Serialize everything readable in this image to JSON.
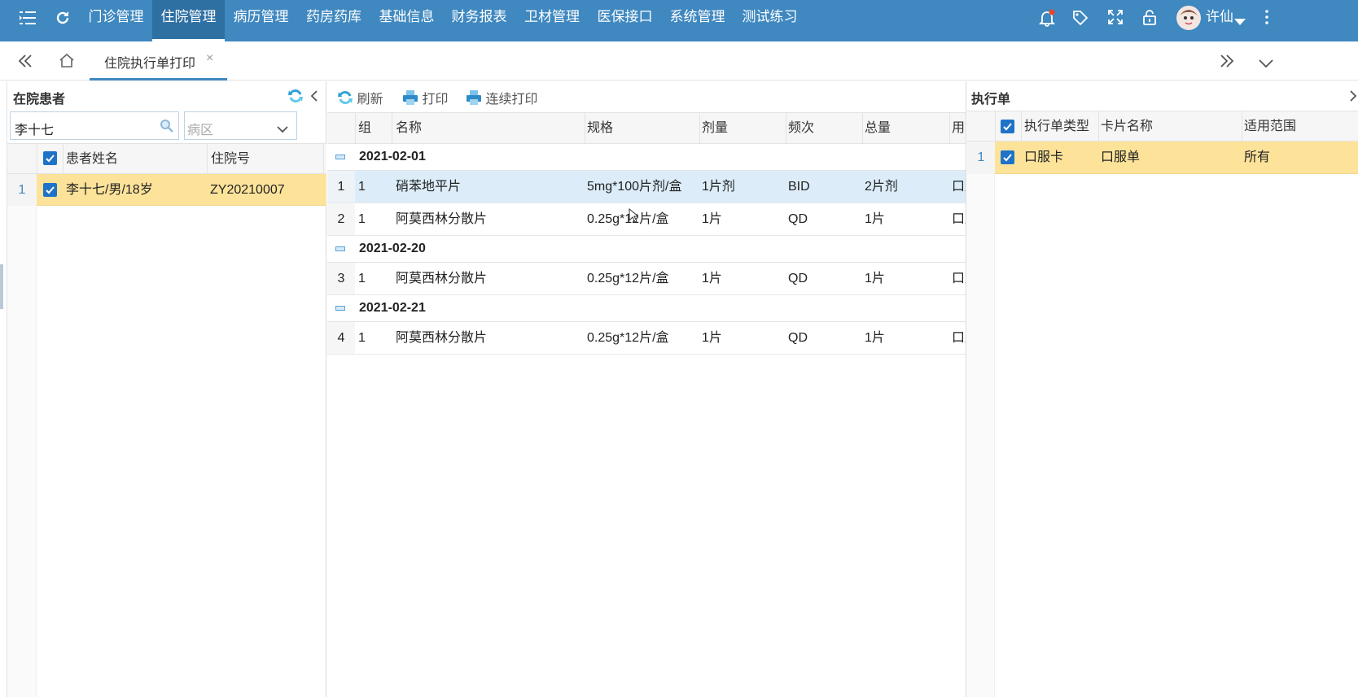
{
  "topbar": {
    "menu": [
      "门诊管理",
      "住院管理",
      "病历管理",
      "药房药库",
      "基础信息",
      "财务报表",
      "卫材管理",
      "医保接口",
      "系统管理",
      "测试练习"
    ],
    "active_index": 1,
    "user": "许仙",
    "icons": [
      "menu-toggle-icon",
      "refresh-icon",
      "bell-icon",
      "tag-icon",
      "fullscreen-icon",
      "lock-icon",
      "avatar",
      "more-icon"
    ]
  },
  "tabstrip": {
    "tab_label": "住院执行单打印",
    "close": "×"
  },
  "left": {
    "title": "在院患者",
    "search_value": "李十七",
    "ward_placeholder": "病区",
    "headers": [
      "患者姓名",
      "住院号"
    ],
    "rows": [
      {
        "num": "1",
        "name": "李十七/男/18岁",
        "inpatient_no": "ZY20210007",
        "checked": true
      }
    ]
  },
  "middle": {
    "toolbar": {
      "refresh": "刷新",
      "print": "打印",
      "continuous_print": "连续打印"
    },
    "headers": [
      "组",
      "名称",
      "规格",
      "剂量",
      "频次",
      "总量",
      "用法"
    ],
    "groups": [
      {
        "date": "2021-02-01",
        "rows": [
          {
            "num": "1",
            "group": "1",
            "name": "硝苯地平片",
            "spec": "5mg*100片剂/盒",
            "dose": "1片剂",
            "freq": "BID",
            "total": "2片剂",
            "usage": "口服"
          },
          {
            "num": "2",
            "group": "1",
            "name": "阿莫西林分散片",
            "spec": "0.25g*12片/盒",
            "dose": "1片",
            "freq": "QD",
            "total": "1片",
            "usage": "口服"
          }
        ]
      },
      {
        "date": "2021-02-20",
        "rows": [
          {
            "num": "3",
            "group": "1",
            "name": "阿莫西林分散片",
            "spec": "0.25g*12片/盒",
            "dose": "1片",
            "freq": "QD",
            "total": "1片",
            "usage": "口服"
          }
        ]
      },
      {
        "date": "2021-02-21",
        "rows": [
          {
            "num": "4",
            "group": "1",
            "name": "阿莫西林分散片",
            "spec": "0.25g*12片/盒",
            "dose": "1片",
            "freq": "QD",
            "total": "1片",
            "usage": "口服"
          }
        ]
      }
    ]
  },
  "right": {
    "title": "执行单",
    "headers": [
      "执行单类型",
      "卡片名称",
      "适用范围"
    ],
    "rows": [
      {
        "num": "1",
        "type": "口服卡",
        "card_name": "口服单",
        "scope": "所有",
        "checked": true
      }
    ]
  },
  "colors": {
    "nav_blue": "#3f88c0",
    "selected_row": "#fde39a",
    "hover_row": "#dcedf9",
    "checkbox": "#1e73c8"
  }
}
